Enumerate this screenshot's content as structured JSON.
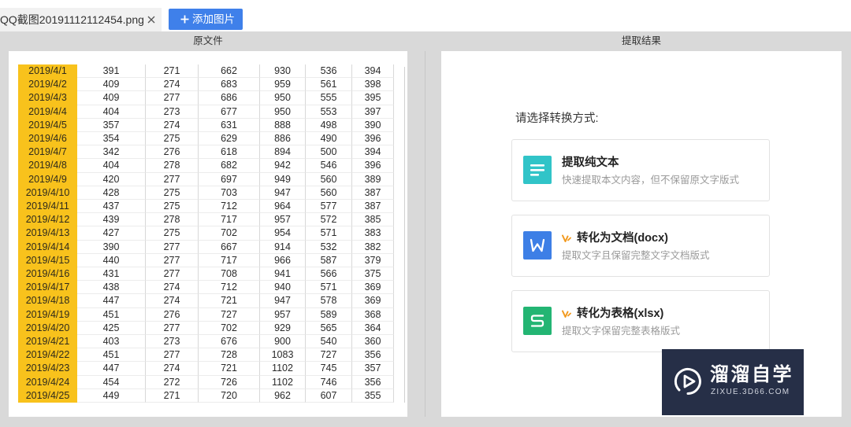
{
  "tabs": [
    {
      "label": "QQ截图20191112112454.png",
      "close_icon": "close-icon"
    }
  ],
  "toolbar": {
    "add_icon": "plus-icon",
    "add_label": "添加图片"
  },
  "panels": {
    "source_title": "原文件",
    "result_title": "提取结果"
  },
  "source_table": {
    "rows": [
      [
        "2019/4/1",
        391,
        271,
        662,
        930,
        536,
        394
      ],
      [
        "2019/4/2",
        409,
        274,
        683,
        959,
        561,
        398
      ],
      [
        "2019/4/3",
        409,
        277,
        686,
        950,
        555,
        395
      ],
      [
        "2019/4/4",
        404,
        273,
        677,
        950,
        553,
        397
      ],
      [
        "2019/4/5",
        357,
        274,
        631,
        888,
        498,
        390
      ],
      [
        "2019/4/6",
        354,
        275,
        629,
        886,
        490,
        396
      ],
      [
        "2019/4/7",
        342,
        276,
        618,
        894,
        500,
        394
      ],
      [
        "2019/4/8",
        404,
        278,
        682,
        942,
        546,
        396
      ],
      [
        "2019/4/9",
        420,
        277,
        697,
        949,
        560,
        389
      ],
      [
        "2019/4/10",
        428,
        275,
        703,
        947,
        560,
        387
      ],
      [
        "2019/4/11",
        437,
        275,
        712,
        964,
        577,
        387
      ],
      [
        "2019/4/12",
        439,
        278,
        717,
        957,
        572,
        385
      ],
      [
        "2019/4/13",
        427,
        275,
        702,
        954,
        571,
        383
      ],
      [
        "2019/4/14",
        390,
        277,
        667,
        914,
        532,
        382
      ],
      [
        "2019/4/15",
        440,
        277,
        717,
        966,
        587,
        379
      ],
      [
        "2019/4/16",
        431,
        277,
        708,
        941,
        566,
        375
      ],
      [
        "2019/4/17",
        438,
        274,
        712,
        940,
        571,
        369
      ],
      [
        "2019/4/18",
        447,
        274,
        721,
        947,
        578,
        369
      ],
      [
        "2019/4/19",
        451,
        276,
        727,
        957,
        589,
        368
      ],
      [
        "2019/4/20",
        425,
        277,
        702,
        929,
        565,
        364
      ],
      [
        "2019/4/21",
        403,
        273,
        676,
        900,
        540,
        360
      ],
      [
        "2019/4/22",
        451,
        277,
        728,
        1083,
        727,
        356
      ],
      [
        "2019/4/23",
        447,
        274,
        721,
        1102,
        745,
        357
      ],
      [
        "2019/4/24",
        454,
        272,
        726,
        1102,
        746,
        356
      ],
      [
        "2019/4/25",
        449,
        271,
        720,
        962,
        607,
        355
      ]
    ]
  },
  "result": {
    "prompt": "请选择转换方式:",
    "options": [
      {
        "title": "提取纯文本",
        "desc": "快速提取本文内容，但不保留原文字版式",
        "icon": "text-lines-icon",
        "icon_color": "#31c4c8",
        "vip": false
      },
      {
        "title": "转化为文档(docx)",
        "desc": "提取文字且保留完整文字文档版式",
        "icon": "word-doc-icon",
        "icon_color": "#3d7fe6",
        "vip": true
      },
      {
        "title": "转化为表格(xlsx)",
        "desc": "提取文字保留完整表格版式",
        "icon": "spreadsheet-icon",
        "icon_color": "#23b573",
        "vip": true
      }
    ]
  },
  "watermark": {
    "icon": "play-circle-icon",
    "brand": "溜溜自学",
    "site": "ZIXUE.3D66.COM"
  },
  "theme": {
    "accent": "#3f80ea",
    "date_highlight": "#f8c21c",
    "vip_color": "#f29a1f",
    "watermark_bg": "#262f47"
  }
}
